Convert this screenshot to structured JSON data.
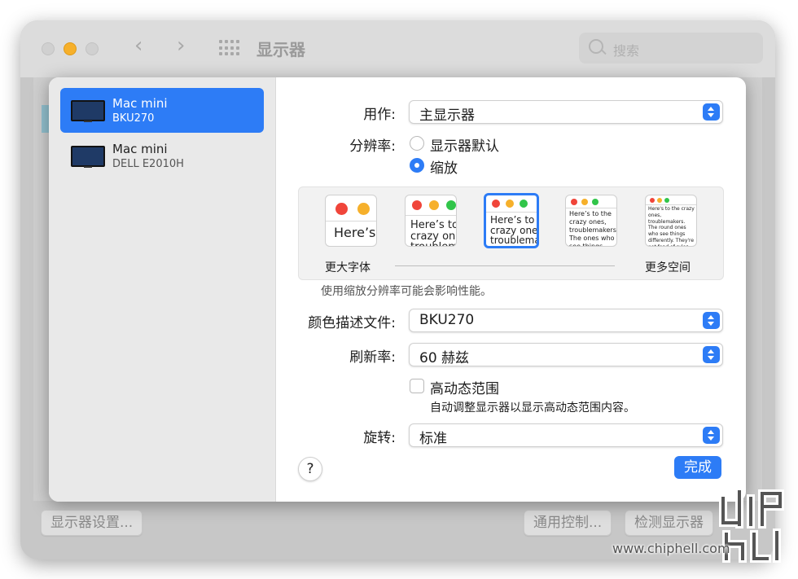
{
  "window": {
    "title": "显示器",
    "search_placeholder": "搜索",
    "bottom_buttons": {
      "display_settings": "显示器设置...",
      "universal_control": "通用控制...",
      "detect_displays": "检测显示器"
    }
  },
  "sidebar": {
    "displays": [
      {
        "name": "Mac mini",
        "model": "BKU270",
        "selected": true
      },
      {
        "name": "Mac mini",
        "model": "DELL E2010H",
        "selected": false
      }
    ]
  },
  "settings": {
    "use_as": {
      "label": "用作:",
      "value": "主显示器"
    },
    "resolution": {
      "label": "分辨率:",
      "options": [
        {
          "label": "显示器默认",
          "selected": false
        },
        {
          "label": "缩放",
          "selected": true
        }
      ]
    },
    "scaling": {
      "thumbnails": [
        {
          "text": "Here’s"
        },
        {
          "text": "Here’s to the crazy ones, troublemakers"
        },
        {
          "text": "Here’s to the crazy ones, troublemakers, ones who see",
          "selected": true
        },
        {
          "text": "Here’s to the crazy ones, troublemakers. The ones who see things differently. They're not fond of rules. And they have"
        },
        {
          "text": "Here's to the crazy ones, troublemakers. The round ones who see things differently. They're not fond of rules. And they have no respect. You can quote them, disagree with them. About the only thing you can't do is ignore them. Because they change things."
        }
      ],
      "left_label": "更大字体",
      "right_label": "更多空间",
      "note": "使用缩放分辨率可能会影响性能。"
    },
    "color_profile": {
      "label": "颜色描述文件:",
      "value": "BKU270"
    },
    "refresh_rate": {
      "label": "刷新率:",
      "value": "60 赫兹"
    },
    "hdr": {
      "label": "高动态范围",
      "checked": false,
      "note": "自动调整显示器以显示高动态范围内容。"
    },
    "rotation": {
      "label": "旋转:",
      "value": "标准"
    },
    "help": "?",
    "done": "完成"
  },
  "watermark": {
    "logo": "chiphell",
    "url": "www.chiphell.com"
  },
  "colors": {
    "accent": "#2d7cf6",
    "traffic_red": "#f0453a",
    "traffic_yellow": "#f6b02b",
    "traffic_green": "#31c54a"
  }
}
